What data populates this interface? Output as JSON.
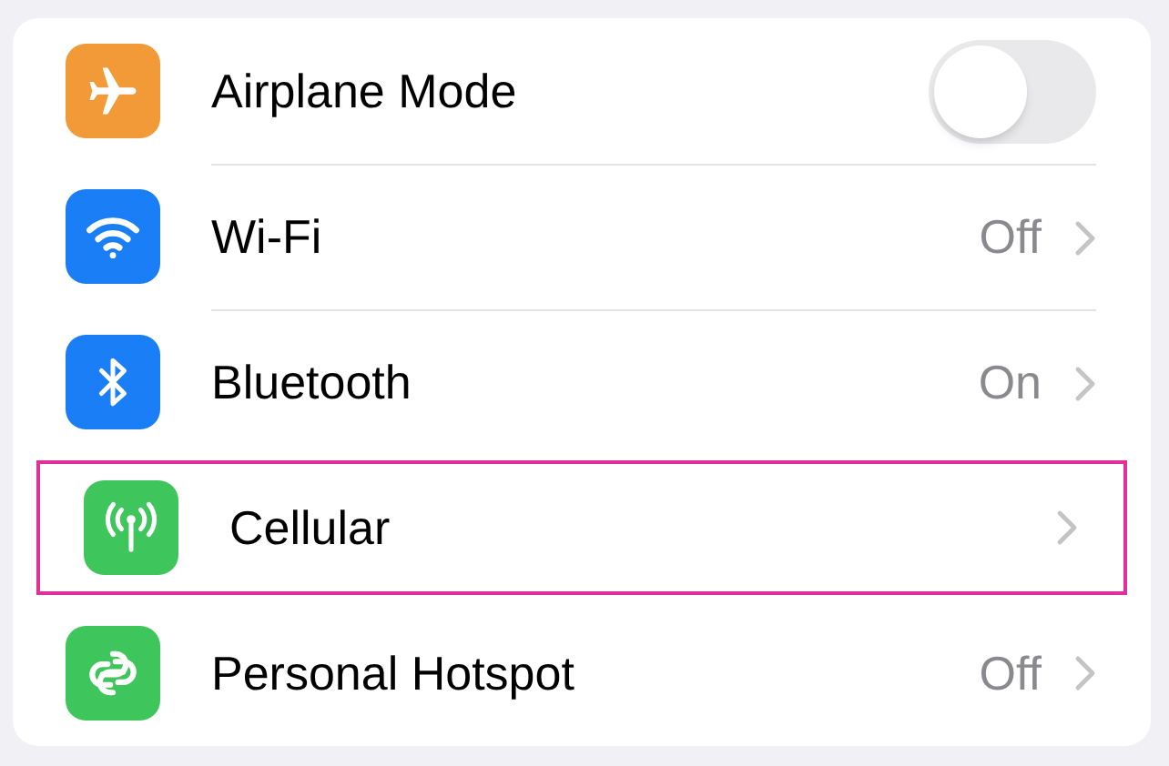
{
  "settings": [
    {
      "kind": "toggle",
      "label": "Airplane Mode",
      "color": "#f29a38",
      "on": false,
      "highlighted": false
    },
    {
      "kind": "link",
      "label": "Wi-Fi",
      "value": "Off",
      "color": "#1a7ef7",
      "highlighted": false
    },
    {
      "kind": "link",
      "label": "Bluetooth",
      "value": "On",
      "color": "#1a7ef7",
      "highlighted": false
    },
    {
      "kind": "link",
      "label": "Cellular",
      "color": "#3ec65d",
      "highlighted": true
    },
    {
      "kind": "link",
      "label": "Personal Hotspot",
      "value": "Off",
      "color": "#3ec65d",
      "highlighted": false
    }
  ]
}
